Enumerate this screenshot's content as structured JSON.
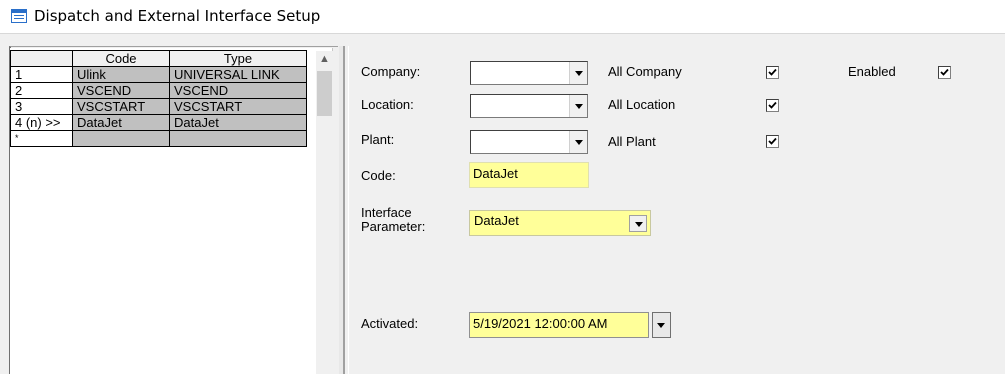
{
  "window": {
    "title": "Dispatch and External Interface Setup"
  },
  "grid": {
    "headers": [
      "",
      "Code",
      "Type"
    ],
    "rows": [
      {
        "index": "1",
        "code": "Ulink",
        "type": "UNIVERSAL LINK"
      },
      {
        "index": "2",
        "code": "VSCEND",
        "type": "VSCEND"
      },
      {
        "index": "3",
        "code": "VSCSTART",
        "type": "VSCSTART"
      },
      {
        "index": "4 (n) >>",
        "code": "DataJet",
        "type": "DataJet"
      },
      {
        "index": "*",
        "code": "",
        "type": ""
      }
    ]
  },
  "form": {
    "company_label": "Company:",
    "company_value": "",
    "location_label": "Location:",
    "location_value": "",
    "plant_label": "Plant:",
    "plant_value": "",
    "code_label": "Code:",
    "code_value": "DataJet",
    "interface_label_line1": "Interface",
    "interface_label_line2": "Parameter:",
    "interface_value": "DataJet",
    "activated_label": "Activated:",
    "activated_value": "5/19/2021 12:00:00 AM",
    "all_company_label": "All Company",
    "all_company_checked": true,
    "all_location_label": "All Location",
    "all_location_checked": true,
    "all_plant_label": "All Plant",
    "all_plant_checked": true,
    "enabled_label": "Enabled",
    "enabled_checked": true
  },
  "icons": {
    "window": "form-window-icon",
    "checkbox": "checkmark-icon",
    "dropdown": "chevron-down-icon",
    "scroll_up": "arrow-up-icon"
  },
  "colors": {
    "highlight_field": "#ffff99",
    "accent": "#2a6fc9"
  }
}
